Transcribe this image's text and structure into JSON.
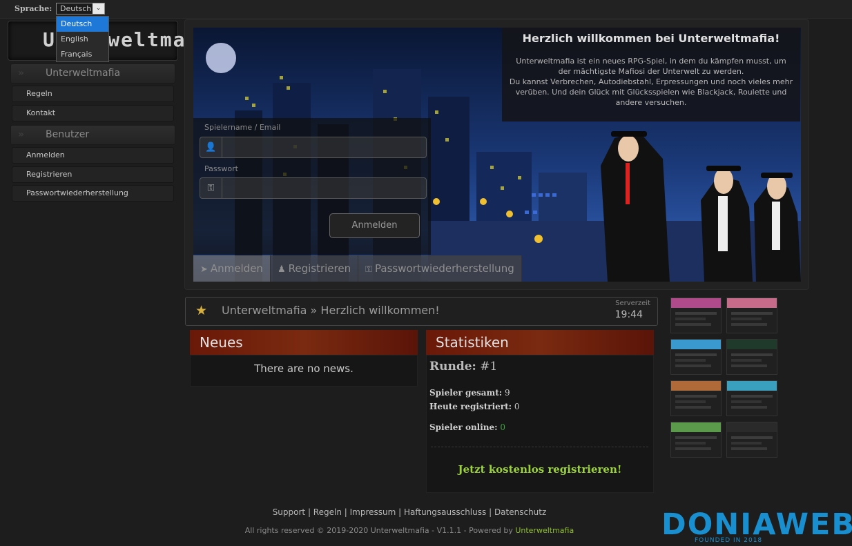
{
  "topbar": {
    "language_label": "Sprache:",
    "selected_language": "Deutsch",
    "language_options": [
      "Deutsch",
      "English",
      "Français"
    ]
  },
  "logo": {
    "text": "Unterweltmafia"
  },
  "sidebar": {
    "sections": [
      {
        "title": "Unterweltmafia",
        "items": [
          "Regeln",
          "Kontakt"
        ]
      },
      {
        "title": "Benutzer",
        "items": [
          "Anmelden",
          "Registrieren",
          "Passwortwiederherstellung"
        ]
      }
    ]
  },
  "hero": {
    "welcome_title": "Herzlich willkommen bei Unterweltmafia!",
    "welcome_text_1": "Unterweltmafia ist ein neues RPG-Spiel, in dem du kämpfen musst, um der mächtigste Mafiosi der Unterwelt zu werden.",
    "welcome_text_2": "Du kannst Verbrechen, Autodiebstahl, Erpressungen und noch vieles mehr verüben. Und dein Glück mit Glücksspielen wie Blackjack, Roulette und andere versuchen.",
    "login": {
      "username_label": "Spielername / Email",
      "password_label": "Passwort",
      "username_value": "",
      "password_value": "",
      "submit_label": "Anmelden"
    },
    "tabs": [
      {
        "label": "Anmelden",
        "icon": "rocket-icon"
      },
      {
        "label": "Registrieren",
        "icon": "users-icon"
      },
      {
        "label": "Passwortwiederherstellung",
        "icon": "key-icon"
      }
    ]
  },
  "breadcrumb": {
    "text": "Unterweltmafia » Herzlich willkommen!",
    "server_time_label": "Serverzeit",
    "server_time": "19:44"
  },
  "news": {
    "title": "Neues",
    "empty_text": "There are no news."
  },
  "stats": {
    "title": "Statistiken",
    "round_label": "Runde:",
    "round_value": "#1",
    "players_total_label": "Spieler gesamt:",
    "players_total": "9",
    "registered_today_label": "Heute registriert:",
    "registered_today": "0",
    "players_online_label": "Spieler online:",
    "players_online": "0",
    "register_cta": "Jetzt kostenlos registrieren!"
  },
  "footer": {
    "links": [
      "Support",
      "Regeln",
      "Impressum",
      "Haftungsausschluss",
      "Datenschutz"
    ],
    "copyright": "All rights reserved © 2019-2020 Unterweltmafia - V1.1.1 - Powered by",
    "powered_by": "Unterweltmafia"
  },
  "watermark": {
    "brand": "DONIAWEB",
    "tagline": "FOUNDED IN 2018"
  },
  "colors": {
    "accent_green": "#9ad23a",
    "panel_red": "#6a1808",
    "online_green": "#3fa83f",
    "brand_blue": "#1a8fd0"
  }
}
